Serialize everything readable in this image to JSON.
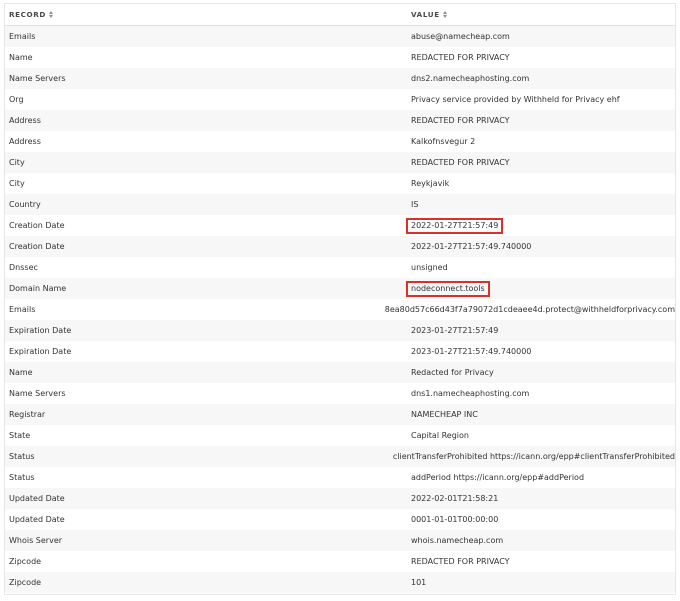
{
  "table": {
    "columns": [
      {
        "label": "RECORD",
        "sort_icon": "sort-updown-icon"
      },
      {
        "label": "VALUE",
        "sort_icon": "sort-updown-icon"
      }
    ],
    "rows": [
      {
        "record": "Emails",
        "value": "abuse@namecheap.com",
        "highlighted": false
      },
      {
        "record": "Name",
        "value": "REDACTED FOR PRIVACY",
        "highlighted": false
      },
      {
        "record": "Name Servers",
        "value": "dns2.namecheaphosting.com",
        "highlighted": false
      },
      {
        "record": "Org",
        "value": "Privacy service provided by Withheld for Privacy ehf",
        "highlighted": false
      },
      {
        "record": "Address",
        "value": "REDACTED FOR PRIVACY",
        "highlighted": false
      },
      {
        "record": "Address",
        "value": "Kalkofnsvegur 2",
        "highlighted": false
      },
      {
        "record": "City",
        "value": "REDACTED FOR PRIVACY",
        "highlighted": false
      },
      {
        "record": "City",
        "value": "Reykjavik",
        "highlighted": false
      },
      {
        "record": "Country",
        "value": "IS",
        "highlighted": false
      },
      {
        "record": "Creation Date",
        "value": "2022-01-27T21:57:49",
        "highlighted": true
      },
      {
        "record": "Creation Date",
        "value": "2022-01-27T21:57:49.740000",
        "highlighted": false
      },
      {
        "record": "Dnssec",
        "value": "unsigned",
        "highlighted": false
      },
      {
        "record": "Domain Name",
        "value": "nodeconnect.tools",
        "highlighted": true
      },
      {
        "record": "Emails",
        "value": "8ea80d57c66d43f7a79072d1cdeaee4d.protect@withheldforprivacy.com",
        "highlighted": false
      },
      {
        "record": "Expiration Date",
        "value": "2023-01-27T21:57:49",
        "highlighted": false
      },
      {
        "record": "Expiration Date",
        "value": "2023-01-27T21:57:49.740000",
        "highlighted": false
      },
      {
        "record": "Name",
        "value": "Redacted for Privacy",
        "highlighted": false
      },
      {
        "record": "Name Servers",
        "value": "dns1.namecheaphosting.com",
        "highlighted": false
      },
      {
        "record": "Registrar",
        "value": "NAMECHEAP INC",
        "highlighted": false
      },
      {
        "record": "State",
        "value": "Capital Region",
        "highlighted": false
      },
      {
        "record": "Status",
        "value": "clientTransferProhibited https://icann.org/epp#clientTransferProhibited",
        "highlighted": false
      },
      {
        "record": "Status",
        "value": "addPeriod https://icann.org/epp#addPeriod",
        "highlighted": false
      },
      {
        "record": "Updated Date",
        "value": "2022-02-01T21:58:21",
        "highlighted": false
      },
      {
        "record": "Updated Date",
        "value": "0001-01-01T00:00:00",
        "highlighted": false
      },
      {
        "record": "Whois Server",
        "value": "whois.namecheap.com",
        "highlighted": false
      },
      {
        "record": "Zipcode",
        "value": "REDACTED FOR PRIVACY",
        "highlighted": false
      },
      {
        "record": "Zipcode",
        "value": "101",
        "highlighted": false
      }
    ]
  },
  "colors": {
    "highlight_border": "#d9302c",
    "row_stripe": "#f7f7f7",
    "header_border": "#e2e2e2"
  }
}
